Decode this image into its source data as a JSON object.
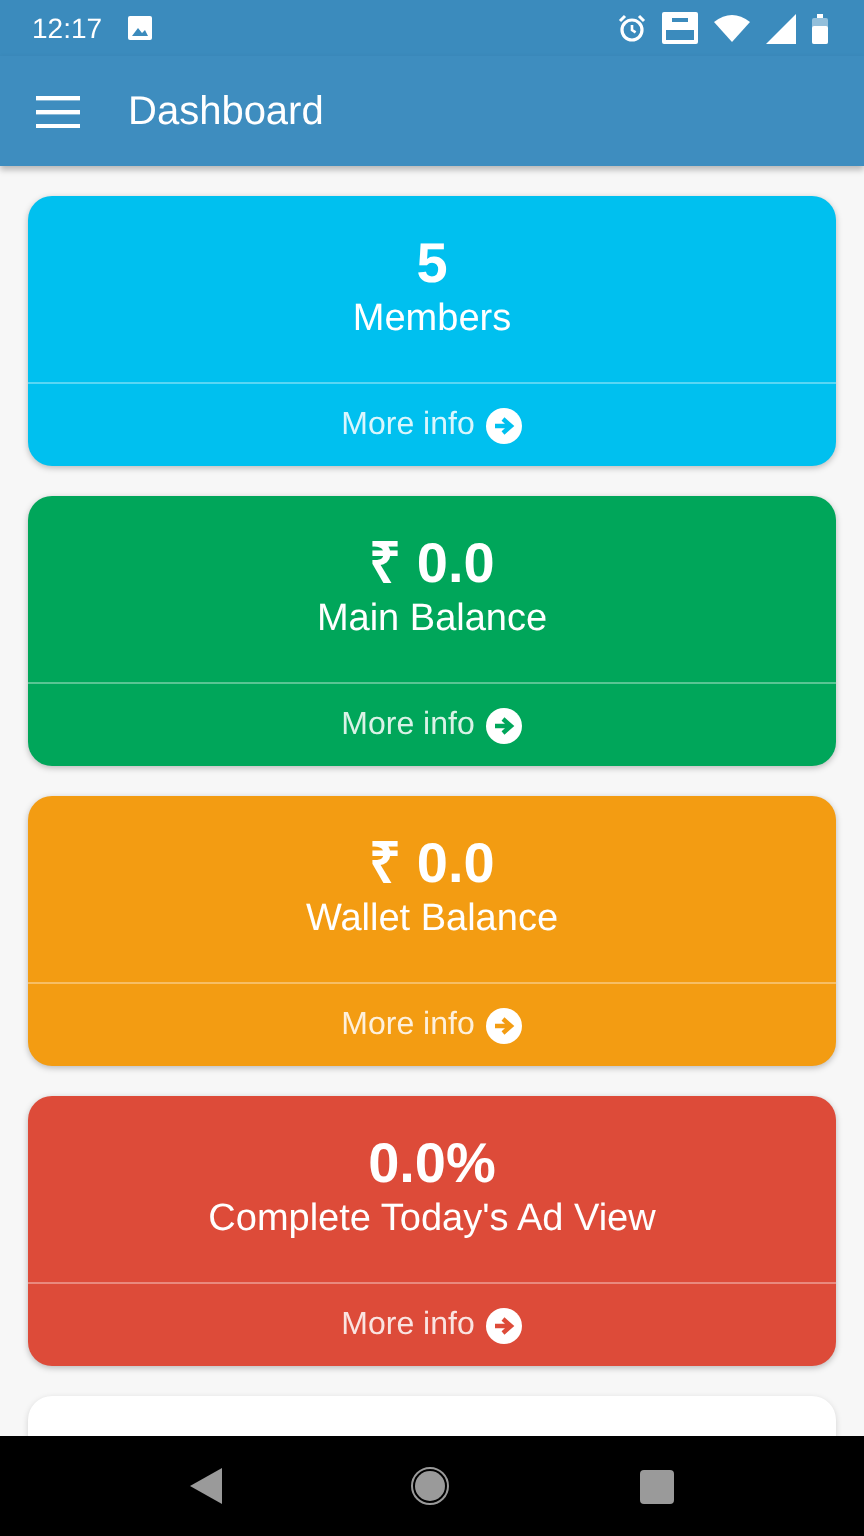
{
  "status_bar": {
    "time": "12:17"
  },
  "app_bar": {
    "title": "Dashboard"
  },
  "cards": [
    {
      "value": "5",
      "label": "Members",
      "link": "More info",
      "color": "#00c0ef"
    },
    {
      "value": "₹ 0.0",
      "label": "Main Balance",
      "link": "More info",
      "color": "#00a65a"
    },
    {
      "value": "₹ 0.0",
      "label": "Wallet Balance",
      "link": "More info",
      "color": "#f39c12"
    },
    {
      "value": "0.0%",
      "label": "Complete Today's Ad View",
      "link": "More info",
      "color": "#dd4b39"
    }
  ]
}
